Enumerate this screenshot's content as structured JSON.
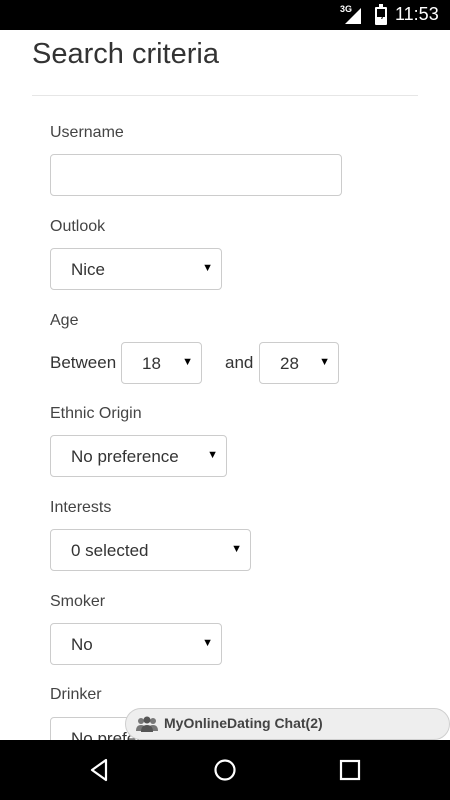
{
  "status_bar": {
    "network": "3G",
    "time": "11:53"
  },
  "page": {
    "title": "Search criteria"
  },
  "form": {
    "username": {
      "label": "Username",
      "value": ""
    },
    "outlook": {
      "label": "Outlook",
      "value": "Nice"
    },
    "age": {
      "label": "Age",
      "between_label": "Between",
      "and_label": "and",
      "min": "18",
      "max": "28"
    },
    "ethnic_origin": {
      "label": "Ethnic Origin",
      "value": "No preference"
    },
    "interests": {
      "label": "Interests",
      "value": "0 selected"
    },
    "smoker": {
      "label": "Smoker",
      "value": "No"
    },
    "drinker": {
      "label": "Drinker",
      "value": "No preference"
    }
  },
  "chat_bar": {
    "label": "MyOnlineDating Chat(2)"
  },
  "nav_bar": {
    "icons": [
      "back-icon",
      "home-icon",
      "recents-icon"
    ]
  }
}
